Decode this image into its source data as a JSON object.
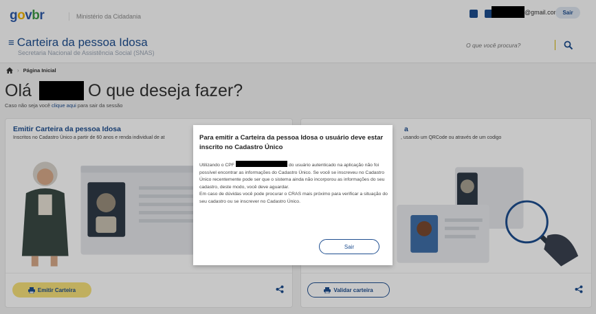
{
  "header": {
    "logo": {
      "g": "g",
      "o": "o",
      "v": "v",
      "b": "b",
      "r": "r"
    },
    "ministry": "Ministério da Cidadania",
    "email_suffix": "@gmail.com",
    "logout_label": "Sair",
    "app_title": "Carteira da pessoa Idosa",
    "secretaria": "Secretaria Nacional de Assistência Social (SNAS)",
    "search_placeholder": "O que você procura?"
  },
  "breadcrumb": {
    "home_icon": "home-icon",
    "current": "Página Inicial"
  },
  "greeting": {
    "hello": "Olá",
    "question": "O que deseja fazer?",
    "exit_prefix": "Caso não seja você",
    "exit_link": "clique aqui",
    "exit_suffix": "para sair da sessão"
  },
  "cards": [
    {
      "title": "Emitir Carteira da pessoa Idosa",
      "desc": "Inscritos no Cadastro Único a partir de 60 anos e renda individual de at",
      "button": "Emitir Carteira"
    },
    {
      "title": "a",
      "desc": ", usando um QRCode ou através de um codigo",
      "button": "Validar carteira"
    }
  ],
  "modal": {
    "title": "Para emitir a Carteira da pessoa Idosa o usuário deve estar inscrito no Cadastro Único",
    "body_prefix": "Utilizando o CPF",
    "body_main": "do usuário autenticado na aplicação não foi possível encontrar as informações do Cadastro Único. Se você se inscreveu no Cadastro Único recentemente pode ser que o sistema ainda não incorporou as informações do seu cadastro, deste modo, você deve aguardar.",
    "body_second": "Em caso de dúvidas você pode procurar o CRAS mais próximo para verificar a situação do seu cadastro ou se inscrever no Cadastro Único.",
    "button": "Sair"
  },
  "colors": {
    "primary": "#1d4d8f",
    "accent": "#f6e17a"
  }
}
